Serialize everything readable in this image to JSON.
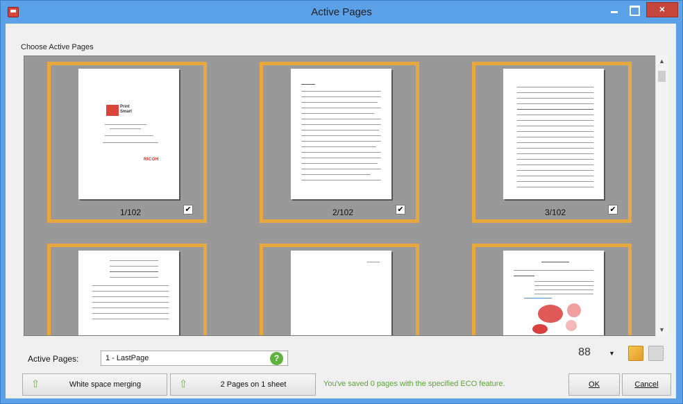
{
  "window": {
    "title": "Active Pages",
    "close_glyph": "×"
  },
  "group_label": "Choose Active Pages",
  "pages": [
    {
      "label": "1/102",
      "checked": true
    },
    {
      "label": "2/102",
      "checked": true
    },
    {
      "label": "3/102",
      "checked": true
    },
    {
      "label": "",
      "checked": false
    },
    {
      "label": "",
      "checked": false
    },
    {
      "label": "",
      "checked": false
    }
  ],
  "thumbnail_text": {
    "logo_line1": "Print",
    "logo_line2": "Smart",
    "brand": "RICOH"
  },
  "check_glyph": "✔",
  "scroll": {
    "up": "▲",
    "down": "▼"
  },
  "active_pages": {
    "label": "Active Pages:",
    "value": "1 - LastPage",
    "help_glyph": "?"
  },
  "layout_icon_glyph": "88",
  "layout_dropdown_glyph": "▼",
  "buttons": {
    "white_space": "White space merging",
    "two_pages": "2 Pages on 1 sheet",
    "arrow_glyph": "⇧",
    "ok": "OK",
    "cancel": "Cancel"
  },
  "status": "You've saved 0 pages with the specified ECO feature.",
  "colors": {
    "titlebar": "#5ba1e8",
    "tile_border": "#e8a83e",
    "viewer_bg": "#999999",
    "status_text": "#5aa634"
  }
}
